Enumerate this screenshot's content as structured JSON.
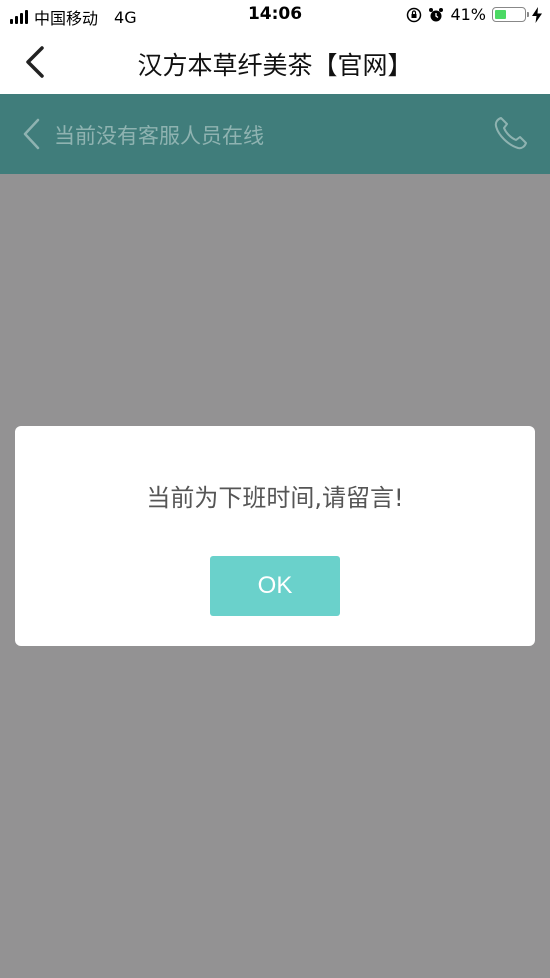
{
  "status_bar": {
    "carrier": "中国移动",
    "network": "4G",
    "time": "14:06",
    "battery_percent": "41%",
    "battery_level": 0.41,
    "icons": [
      "signal-icon",
      "orientation-lock-icon",
      "alarm-icon",
      "battery-icon",
      "charging-icon"
    ]
  },
  "nav": {
    "title": "汉方本草纤美茶【官网】",
    "back_icon": "chevron-left-icon"
  },
  "service_header": {
    "status": "当前没有客服人员在线",
    "back_icon": "chevron-left-icon",
    "phone_icon": "phone-icon"
  },
  "dialog": {
    "message": "当前为下班时间,请留言!",
    "ok_label": "OK"
  },
  "colors": {
    "header_teal": "#407d7b",
    "header_text": "#8fb3b1",
    "overlay": "#939293",
    "ok_button": "#6ad1cb",
    "battery_green": "#4cd964"
  }
}
